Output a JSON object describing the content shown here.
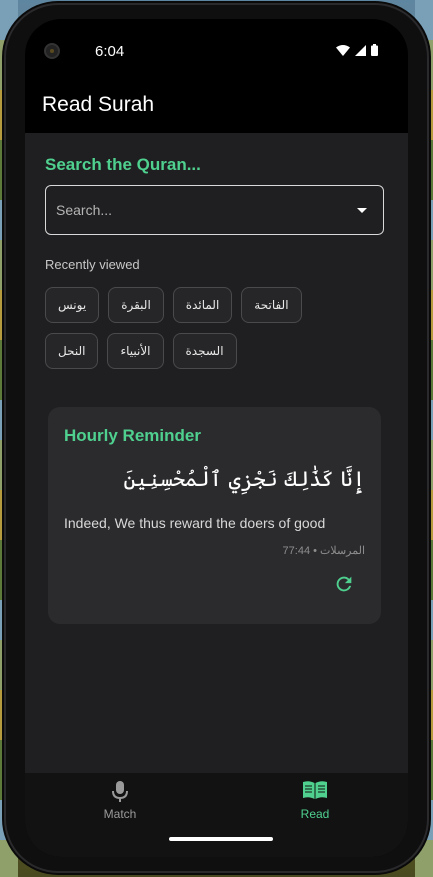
{
  "status_bar": {
    "time": "6:04"
  },
  "app_bar": {
    "title": "Read Surah"
  },
  "search": {
    "heading": "Search the Quran...",
    "placeholder": "Search..."
  },
  "recently_viewed": {
    "label": "Recently viewed",
    "chips": [
      "الفاتحة",
      "المائدة",
      "البقرة",
      "يونس",
      "السجدة",
      "الأنبياء",
      "النحل"
    ]
  },
  "reminder": {
    "title": "Hourly Reminder",
    "arabic": "إِنَّا كَذَٰلِكَ نَجْزِي ٱلْمُحْسِنِينَ",
    "translation": "Indeed, We thus reward the doers of good",
    "reference": "المرسلات • 77:44"
  },
  "bottom_nav": {
    "items": [
      {
        "label": "Match",
        "icon": "mic-icon",
        "active": false
      },
      {
        "label": "Read",
        "icon": "book-icon",
        "active": true
      }
    ]
  },
  "colors": {
    "accent": "#4fd08f",
    "background": "#1f1f21",
    "card": "#2b2b2e"
  }
}
